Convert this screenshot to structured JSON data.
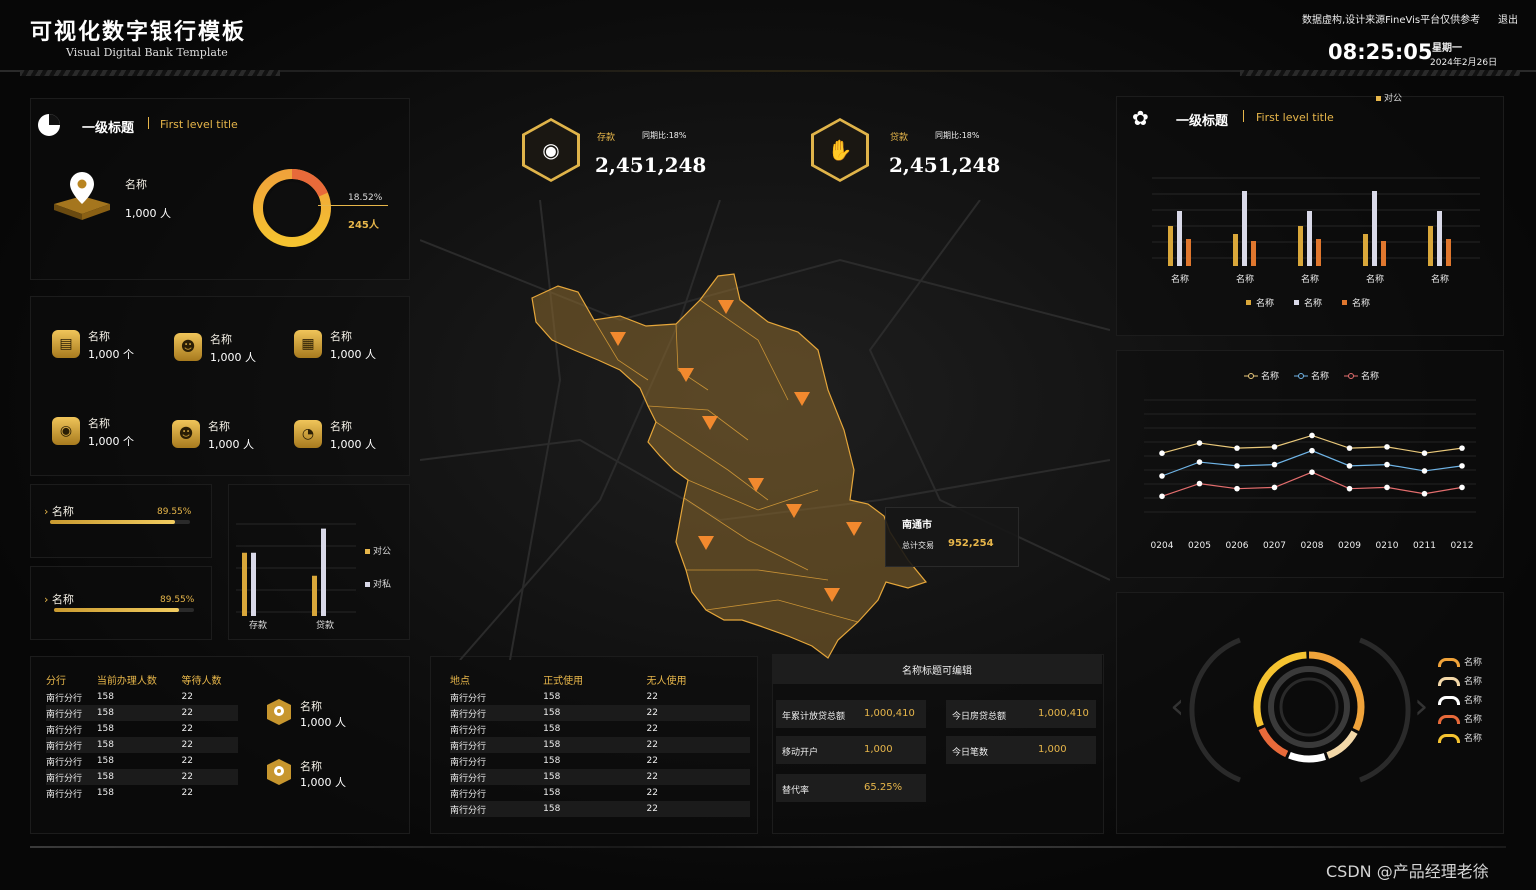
{
  "header": {
    "title": "可视化数字银行模板",
    "subtitle": "Visual Digital Bank Template",
    "notice": "数据虚构,设计来源FineVis平台仅供参考",
    "exit": "退出",
    "time": "08:25:05",
    "weekday": "星期一",
    "date": "2024年2月26日"
  },
  "left_top": {
    "title": "一级标题",
    "title_en": "First level title",
    "metric_label": "名称",
    "metric_value": "1,000 人",
    "donut_pct": "18.52%",
    "donut_count": "245人",
    "donut_fraction": 0.1852
  },
  "left_icons": [
    {
      "label": "名称",
      "value": "1,000 个",
      "icon": "document-icon"
    },
    {
      "label": "名称",
      "value": "1,000 人",
      "icon": "user-icon"
    },
    {
      "label": "名称",
      "value": "1,000 人",
      "icon": "grid-icon"
    },
    {
      "label": "名称",
      "value": "1,000 个",
      "icon": "location-icon"
    },
    {
      "label": "名称",
      "value": "1,000 人",
      "icon": "user-icon"
    },
    {
      "label": "名称",
      "value": "1,000 人",
      "icon": "pie-icon"
    }
  ],
  "progress": [
    {
      "label": "名称",
      "pct": "89.55%",
      "fraction": 0.8955
    },
    {
      "label": "名称",
      "pct": "89.55%",
      "fraction": 0.8955
    }
  ],
  "small_bar": {
    "categories": [
      "存款",
      "贷款"
    ],
    "legend": [
      "对公",
      "对私"
    ]
  },
  "branch_table": {
    "headers": [
      "分行",
      "当前办理人数",
      "等待人数"
    ],
    "rows": [
      [
        "南行分行",
        "158",
        "22"
      ],
      [
        "南行分行",
        "158",
        "22"
      ],
      [
        "南行分行",
        "158",
        "22"
      ],
      [
        "南行分行",
        "158",
        "22"
      ],
      [
        "南行分行",
        "158",
        "22"
      ],
      [
        "南行分行",
        "158",
        "22"
      ],
      [
        "南行分行",
        "158",
        "22"
      ]
    ],
    "side": [
      {
        "label": "名称",
        "value": "1,000 人"
      },
      {
        "label": "名称",
        "value": "1,000 人"
      }
    ]
  },
  "place_table": {
    "headers": [
      "地点",
      "正式使用",
      "无人使用"
    ],
    "rows": [
      [
        "南行分行",
        "158",
        "22"
      ],
      [
        "南行分行",
        "158",
        "22"
      ],
      [
        "南行分行",
        "158",
        "22"
      ],
      [
        "南行分行",
        "158",
        "22"
      ],
      [
        "南行分行",
        "158",
        "22"
      ],
      [
        "南行分行",
        "158",
        "22"
      ],
      [
        "南行分行",
        "158",
        "22"
      ],
      [
        "南行分行",
        "158",
        "22"
      ]
    ]
  },
  "kpis": {
    "title": "名称标题可编辑",
    "items": [
      {
        "k": "年累计放贷总额",
        "v": "1,000,410"
      },
      {
        "k": "今日房贷总额",
        "v": "1,000,410"
      },
      {
        "k": "移动开户",
        "v": "1,000"
      },
      {
        "k": "今日笔数",
        "v": "1,000"
      },
      {
        "k": "替代率",
        "v": "65.25%"
      }
    ]
  },
  "center": {
    "deposit_label": "存款",
    "deposit_yoy": "同期比:18%",
    "deposit_value": "2,451,248",
    "loan_label": "贷款",
    "loan_yoy": "同期比:18%",
    "loan_value": "2,451,248",
    "tooltip_city": "南通市",
    "tooltip_key": "总计交易",
    "tooltip_value": "952,254"
  },
  "right_top": {
    "title": "一级标题",
    "title_en": "First level title",
    "top_legend": "对公"
  },
  "chart_data": [
    {
      "type": "bar",
      "categories": [
        "名称",
        "名称",
        "名称",
        "名称",
        "名称"
      ],
      "series": [
        {
          "name": "名称",
          "values": [
            4,
            3.2,
            4,
            3.2,
            4
          ]
        },
        {
          "name": "名称",
          "values": [
            5.5,
            7.5,
            5.5,
            7.5,
            5.5
          ]
        },
        {
          "name": "名称",
          "values": [
            2.7,
            2.5,
            2.7,
            2.5,
            2.7
          ]
        }
      ],
      "ylim": [
        0,
        8
      ]
    },
    {
      "type": "line",
      "x": [
        "0204",
        "0205",
        "0206",
        "0207",
        "0208",
        "0209",
        "0210",
        "0211",
        "0212"
      ],
      "series": [
        {
          "name": "名称",
          "values": [
            48,
            56,
            52,
            53,
            62,
            52,
            53,
            48,
            52
          ]
        },
        {
          "name": "名称",
          "values": [
            30,
            41,
            38,
            39,
            50,
            38,
            39,
            34,
            38
          ]
        },
        {
          "name": "名称",
          "values": [
            14,
            24,
            20,
            21,
            33,
            20,
            21,
            16,
            21
          ]
        }
      ],
      "ylim": [
        0,
        90
      ]
    },
    {
      "type": "bar",
      "categories": [
        "存款",
        "贷款"
      ],
      "series": [
        {
          "name": "对公",
          "values": [
            5.5,
            3.5
          ]
        },
        {
          "name": "对私",
          "values": [
            5.5,
            7.6
          ]
        }
      ],
      "ylim": [
        0,
        8
      ]
    }
  ],
  "ring_legend": [
    {
      "name": "名称",
      "color": "#f0a33a"
    },
    {
      "name": "名称",
      "color": "#f3d8a8"
    },
    {
      "name": "名称",
      "color": "#ffffff"
    },
    {
      "name": "名称",
      "color": "#e86a3a"
    },
    {
      "name": "名称",
      "color": "#f5c330"
    }
  ],
  "ring_shares": [
    0.33,
    0.12,
    0.12,
    0.12,
    0.31
  ],
  "colors": {
    "gold": "#e7b64a",
    "line1": "#e9c87a",
    "line2": "#6fb4e6",
    "line3": "#e36d6d",
    "bar_white": "#d9d9e8",
    "bar_orange": "#e0772e"
  },
  "watermark": "CSDN @产品经理老徐"
}
